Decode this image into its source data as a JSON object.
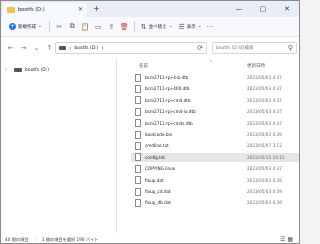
{
  "window": {
    "tab_title": "bootfs (D:)",
    "new_tab": "+",
    "minimize": "—",
    "maximize": "▢",
    "close": "✕"
  },
  "toolbar": {
    "new_label": "新規作成",
    "new_icon": "+",
    "cut_icon": "✂",
    "copy_icon": "⧉",
    "paste_icon": "📋",
    "rename_icon": "▭",
    "share_icon": "⇪",
    "delete_icon": "🗑",
    "sort_label": "並べ替え",
    "sort_icon": "⇅",
    "view_label": "表示",
    "view_icon": "☰",
    "more_icon": "···",
    "dropdown_icon": "⌄"
  },
  "address": {
    "back_icon": "←",
    "forward_icon": "→",
    "up_icon": "↑",
    "history_icon": "⌄",
    "chevron": "›",
    "path": "bootfs (D:)",
    "refresh_icon": "⟳",
    "search_placeholder": "bootfs (D:)の検索",
    "search_icon": "⚲"
  },
  "nav": {
    "items": [
      {
        "label": "bootfs (D:)",
        "chevron": "›"
      }
    ]
  },
  "files": {
    "col_name": "名前",
    "col_date": "更新日時",
    "sort_arrow": "⌃",
    "rows": [
      {
        "name": "bcm2711-rpi-4-b.dtb",
        "date": "2023/05/03 4:37"
      },
      {
        "name": "bcm2711-rpi-400.dtb",
        "date": "2023/05/03 4:37"
      },
      {
        "name": "bcm2711-rpi-cm4.dtb",
        "date": "2023/05/03 4:37"
      },
      {
        "name": "bcm2711-rpi-cm4-io.dtb",
        "date": "2023/05/03 4:37"
      },
      {
        "name": "bcm2711-rpi-cm4s.dtb",
        "date": "2023/05/03 4:37"
      },
      {
        "name": "bootcode.bin",
        "date": "2023/05/03 4:39"
      },
      {
        "name": "cmdline.txt",
        "date": "2023/05/07 3:12"
      },
      {
        "name": "config.txt",
        "date": "2023/05/15 10:15",
        "selected": true
      },
      {
        "name": "COPYING.linux",
        "date": "2023/05/03 4:37"
      },
      {
        "name": "fixup.dat",
        "date": "2023/05/03 4:39"
      },
      {
        "name": "fixup_cd.dat",
        "date": "2023/05/03 4:39"
      },
      {
        "name": "fixup_db.dat",
        "date": "2023/05/03 4:39"
      }
    ]
  },
  "status": {
    "count": "40 個の項目",
    "selection": "1 個の項目を選択 190 バイト",
    "views_icon": "☰ ▦"
  }
}
